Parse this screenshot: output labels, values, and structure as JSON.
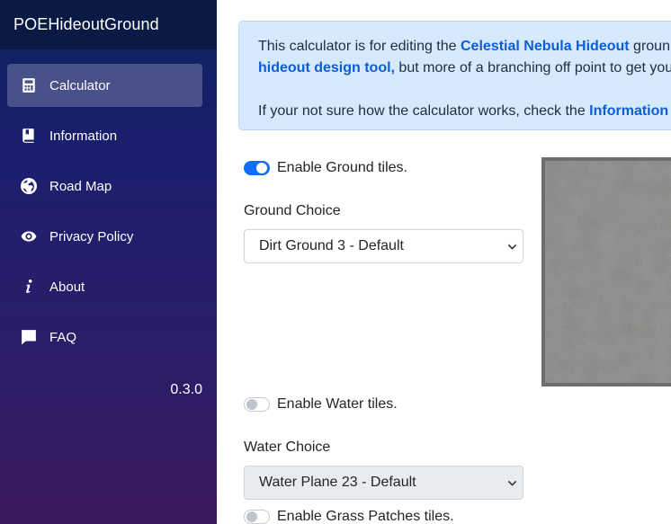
{
  "brand": "POEHideoutGround",
  "nav": [
    {
      "label": "Calculator",
      "icon": "calculator-icon",
      "active": true
    },
    {
      "label": "Information",
      "icon": "book-icon",
      "active": false
    },
    {
      "label": "Road Map",
      "icon": "globe-icon",
      "active": false
    },
    {
      "label": "Privacy Policy",
      "icon": "eye-icon",
      "active": false
    },
    {
      "label": "About",
      "icon": "info-icon",
      "active": false
    },
    {
      "label": "FAQ",
      "icon": "chat-icon",
      "active": false
    }
  ],
  "version": "0.3.0",
  "alert": {
    "line1_pre": "This calculator is for editing the ",
    "line1_link": "Celestial Nebula Hideout",
    "line1_post": " groun",
    "line2_link": "hideout design tool,",
    "line2_post": " but more of a branching off point to get you",
    "line3_pre": "If your not sure how the calculator works, check the ",
    "line3_link": "Information"
  },
  "ground": {
    "toggle_label": "Enable Ground tiles.",
    "enabled": true,
    "choice_label": "Ground Choice",
    "selected": "Dirt Ground 3 - Default"
  },
  "water": {
    "toggle_label": "Enable Water tiles.",
    "enabled": false,
    "choice_label": "Water Choice",
    "selected": "Water Plane 23 - Default"
  },
  "grass": {
    "toggle_label": "Enable Grass Patches tiles.",
    "enabled": false
  },
  "colors": {
    "accent": "#0d6efd",
    "sidebar_top": "#0d2160",
    "sidebar_bottom": "#3b1a5c",
    "alert_bg": "#d7e9fc"
  }
}
